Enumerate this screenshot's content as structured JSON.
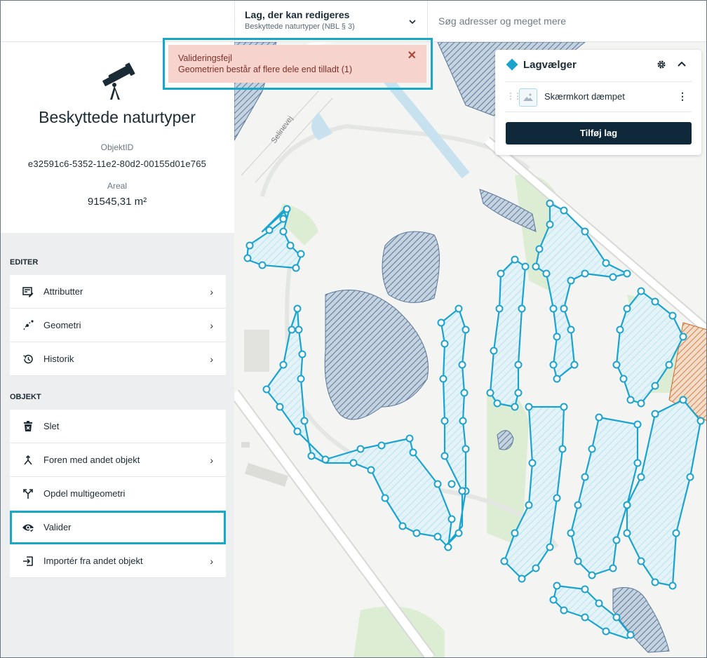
{
  "header": {
    "layer_title": "Lag, der kan redigeres",
    "layer_subtitle": "Beskyttede naturtyper (NBL § 3)",
    "search_placeholder": "Søg adresser og meget mere"
  },
  "toast": {
    "title": "Valideringsfejl",
    "message": "Geometrien består af flere dele end tilladt (1)",
    "close": "✕"
  },
  "object": {
    "name": "Beskyttede naturtyper",
    "id_label": "ObjektID",
    "id_value": "e32591c6-5352-11e2-80d2-00155d01e765",
    "area_label": "Areal",
    "area_value": "91545,31 m²"
  },
  "editer": {
    "heading": "EDITER",
    "items": [
      {
        "label": "Attributter",
        "icon": "form-edit-icon"
      },
      {
        "label": "Geometri",
        "icon": "geometry-edit-icon"
      },
      {
        "label": "Historik",
        "icon": "history-icon"
      }
    ]
  },
  "objekt": {
    "heading": "OBJEKT",
    "items": [
      {
        "label": "Slet",
        "icon": "trash-icon"
      },
      {
        "label": "Foren med andet objekt",
        "icon": "merge-icon"
      },
      {
        "label": "Opdel multigeometri",
        "icon": "split-icon"
      },
      {
        "label": "Valider",
        "icon": "eye-check-icon"
      },
      {
        "label": "Importér fra andet objekt",
        "icon": "import-icon"
      }
    ]
  },
  "layer_panel": {
    "title": "Lagvælger",
    "layer_name": "Skærmkort dæmpet",
    "add_button": "Tilføj lag"
  },
  "map": {
    "road_label": "Selinevej",
    "colors": {
      "selection": "#1aa3cf",
      "water": "#5b7899",
      "warning": "#c96a2e",
      "green": "#d9ecd0"
    }
  }
}
